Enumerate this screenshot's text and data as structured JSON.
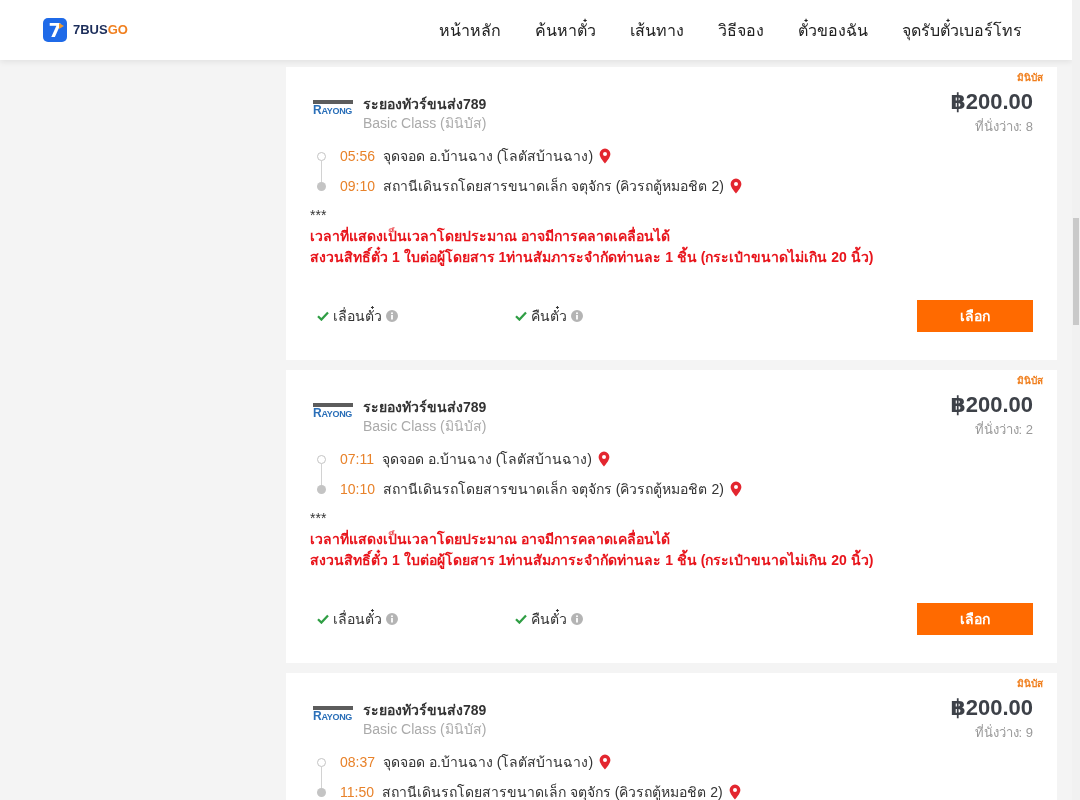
{
  "header": {
    "logo": {
      "mark": "7",
      "text": "7BUS",
      "accent": "GO"
    },
    "nav": [
      "หน้าหลัก",
      "ค้นหาตั๋ว",
      "เส้นทาง",
      "วิธีจอง",
      "ตั๋วของฉัน",
      "จุดรับตั๋วเบอร์โทร"
    ]
  },
  "trips": [
    {
      "vehicle_tag": "มินิบัส",
      "operator_logo": "RAYONG",
      "operator": "ระยองทัวร์ขนส่ง789",
      "class": "Basic Class (มินิบัส)",
      "price": "฿200.00",
      "seats": "ที่นั่งว่าง: 8",
      "stops": [
        {
          "kind": "departure",
          "time": "05:56",
          "place": "จุดจอด อ.บ้านฉาง (โลตัสบ้านฉาง)"
        },
        {
          "kind": "arrival",
          "time": "09:10",
          "place": "สถานีเดินรถโดยสารขนาดเล็ก จตุจักร (คิวรถตู้หมอชิต 2)"
        }
      ],
      "notes": [
        {
          "kind": "plain",
          "text": "***"
        },
        {
          "kind": "warning",
          "text": "เวลาที่แสดงเป็นเวลาโดยประมาณ อาจมีการคลาดเคลื่อนได้"
        },
        {
          "kind": "warning",
          "text": "สงวนสิทธิ์ตั๋ว 1 ใบต่อผู้โดยสาร 1ท่านสัมภาระจำกัดท่านละ 1 ชิ้น (กระเป๋าขนาดไม่เกิน 20 นิ้ว)"
        }
      ],
      "features": [
        {
          "label": "เลื่อนตั๋ว",
          "available": true
        },
        {
          "label": "คืนตั๋ว",
          "available": true
        }
      ],
      "button": "เลือก"
    },
    {
      "vehicle_tag": "มินิบัส",
      "operator_logo": "RAYONG",
      "operator": "ระยองทัวร์ขนส่ง789",
      "class": "Basic Class (มินิบัส)",
      "price": "฿200.00",
      "seats": "ที่นั่งว่าง: 2",
      "stops": [
        {
          "kind": "departure",
          "time": "07:11",
          "place": "จุดจอด อ.บ้านฉาง (โลตัสบ้านฉาง)"
        },
        {
          "kind": "arrival",
          "time": "10:10",
          "place": "สถานีเดินรถโดยสารขนาดเล็ก จตุจักร (คิวรถตู้หมอชิต 2)"
        }
      ],
      "notes": [
        {
          "kind": "plain",
          "text": "***"
        },
        {
          "kind": "warning",
          "text": "เวลาที่แสดงเป็นเวลาโดยประมาณ อาจมีการคลาดเคลื่อนได้"
        },
        {
          "kind": "warning",
          "text": "สงวนสิทธิ์ตั๋ว 1 ใบต่อผู้โดยสาร 1ท่านสัมภาระจำกัดท่านละ 1 ชิ้น (กระเป๋าขนาดไม่เกิน 20 นิ้ว)"
        }
      ],
      "features": [
        {
          "label": "เลื่อนตั๋ว",
          "available": true
        },
        {
          "label": "คืนตั๋ว",
          "available": true
        }
      ],
      "button": "เลือก"
    },
    {
      "vehicle_tag": "มินิบัส",
      "operator_logo": "RAYONG",
      "operator": "ระยองทัวร์ขนส่ง789",
      "class": "Basic Class (มินิบัส)",
      "price": "฿200.00",
      "seats": "ที่นั่งว่าง: 9",
      "stops": [
        {
          "kind": "departure",
          "time": "08:37",
          "place": "จุดจอด อ.บ้านฉาง (โลตัสบ้านฉาง)"
        },
        {
          "kind": "arrival",
          "time": "11:50",
          "place": "สถานีเดินรถโดยสารขนาดเล็ก จตุจักร (คิวรถตู้หมอชิต 2)"
        }
      ]
    }
  ]
}
